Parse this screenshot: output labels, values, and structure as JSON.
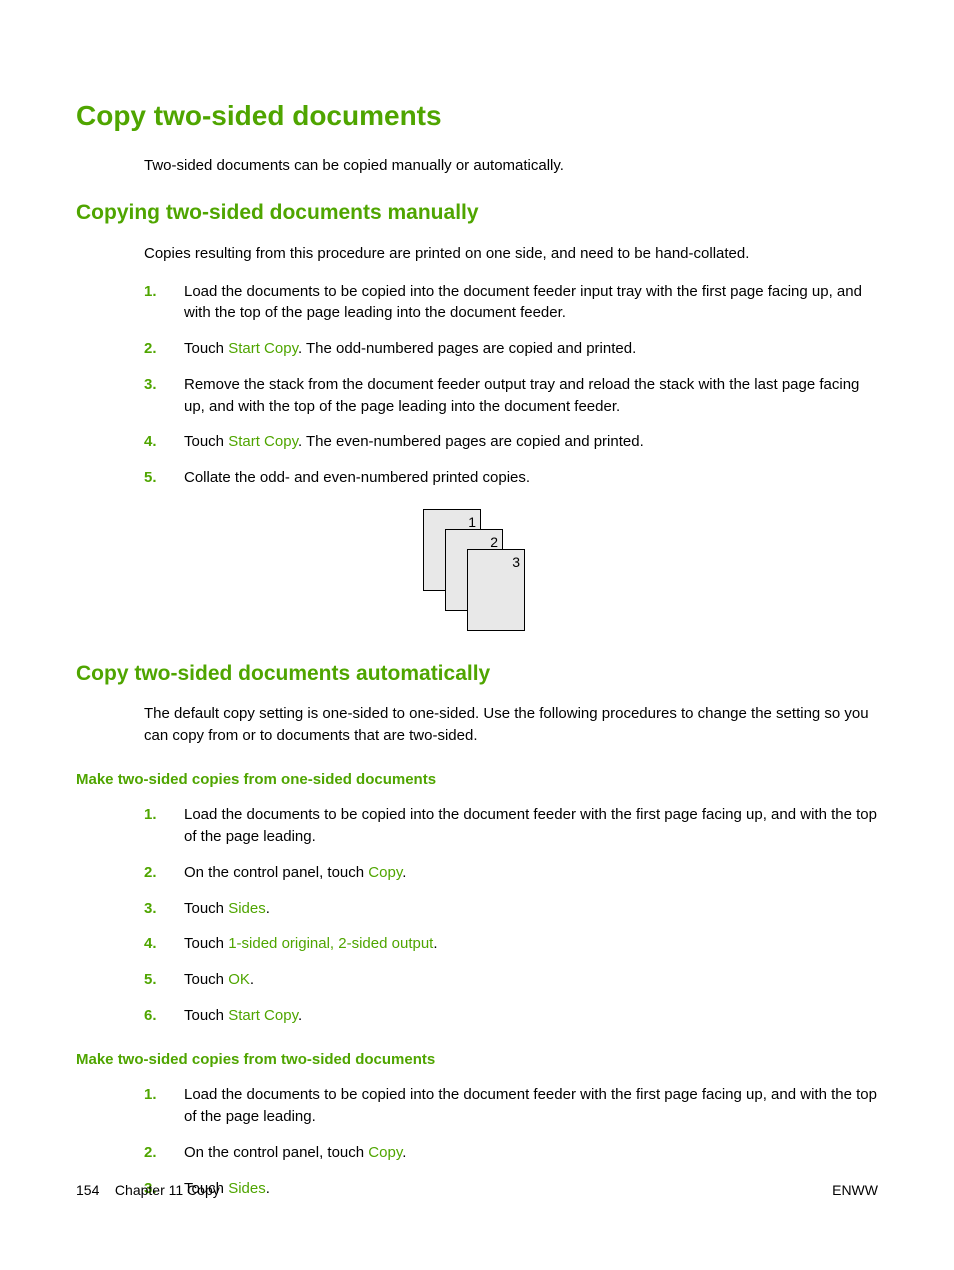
{
  "h1": "Copy two-sided documents",
  "intro": "Two-sided documents can be copied manually or automatically.",
  "manual": {
    "heading": "Copying two-sided documents manually",
    "intro": "Copies resulting from this procedure are printed on one side, and need to be hand-collated.",
    "steps": {
      "s1": "Load the documents to be copied into the document feeder input tray with the first page facing up, and with the top of the page leading into the document feeder.",
      "s2_a": "Touch ",
      "s2_term": "Start Copy",
      "s2_b": ". The odd-numbered pages are copied and printed.",
      "s3": "Remove the stack from the document feeder output tray and reload the stack with the last page facing up, and with the top of the page leading into the document feeder.",
      "s4_a": "Touch ",
      "s4_term": "Start Copy",
      "s4_b": ". The even-numbered pages are copied and printed.",
      "s5": "Collate the odd- and even-numbered printed copies."
    },
    "diagram": {
      "p1": "1",
      "p2": "2",
      "p3": "3"
    }
  },
  "auto": {
    "heading": "Copy two-sided documents automatically",
    "intro": "The default copy setting is one-sided to one-sided. Use the following procedures to change the setting so you can copy from or to documents that are two-sided.",
    "sub1": {
      "heading": "Make two-sided copies from one-sided documents",
      "steps": {
        "s1": "Load the documents to be copied into the document feeder with the first page facing up, and with the top of the page leading.",
        "s2_a": "On the control panel, touch ",
        "s2_term": "Copy",
        "s2_b": ".",
        "s3_a": "Touch ",
        "s3_term": "Sides",
        "s3_b": ".",
        "s4_a": "Touch ",
        "s4_term": "1-sided original, 2-sided output",
        "s4_b": ".",
        "s5_a": "Touch ",
        "s5_term": "OK",
        "s5_b": ".",
        "s6_a": "Touch ",
        "s6_term": "Start Copy",
        "s6_b": "."
      }
    },
    "sub2": {
      "heading": "Make two-sided copies from two-sided documents",
      "steps": {
        "s1": "Load the documents to be copied into the document feeder with the first page facing up, and with the top of the page leading.",
        "s2_a": "On the control panel, touch ",
        "s2_term": "Copy",
        "s2_b": ".",
        "s3_a": "Touch ",
        "s3_term": "Sides",
        "s3_b": "."
      }
    }
  },
  "footer": {
    "left_page": "154",
    "left_chapter": "Chapter 11   Copy",
    "right": "ENWW"
  }
}
